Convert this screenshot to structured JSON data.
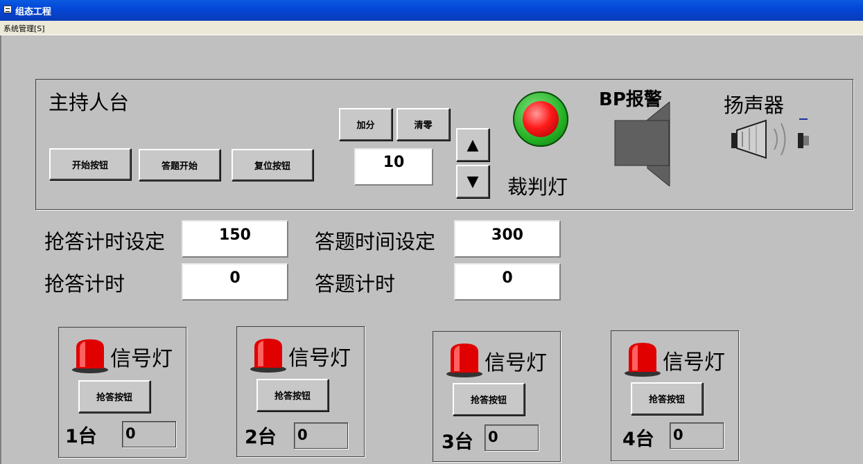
{
  "window": {
    "title": "组态工程"
  },
  "menu": {
    "system": "系统管理[S]"
  },
  "host": {
    "title": "主持人台",
    "buttons": {
      "start": "开始按钮",
      "answer_start": "答题开始",
      "reset": "复位按钮",
      "add_score": "加分",
      "clear": "清零"
    },
    "score_value": "10",
    "judge_lamp_label": "裁判灯",
    "alarm_label": "BP报警",
    "speaker_label": "扬声器"
  },
  "timers": {
    "grab_set_label": "抢答计时设定",
    "grab_set_value": "150",
    "answer_set_label": "答题时间设定",
    "answer_set_value": "300",
    "grab_label": "抢答计时",
    "grab_value": "0",
    "answer_label": "答题计时",
    "answer_value": "0"
  },
  "stations": [
    {
      "signal_label": "信号灯",
      "button_label": "抢答按钮",
      "name": "1台",
      "value": "0"
    },
    {
      "signal_label": "信号灯",
      "button_label": "抢答按钮",
      "name": "2台",
      "value": "0"
    },
    {
      "signal_label": "信号灯",
      "button_label": "抢答按钮",
      "name": "3台",
      "value": "0"
    },
    {
      "signal_label": "信号灯",
      "button_label": "抢答按钮",
      "name": "4台",
      "value": "0"
    }
  ],
  "colors": {
    "title_bar": "#0347d8",
    "canvas": "#c0c0c0",
    "lamp_red": "#ff0000",
    "lamp_ring": "#22b022"
  }
}
